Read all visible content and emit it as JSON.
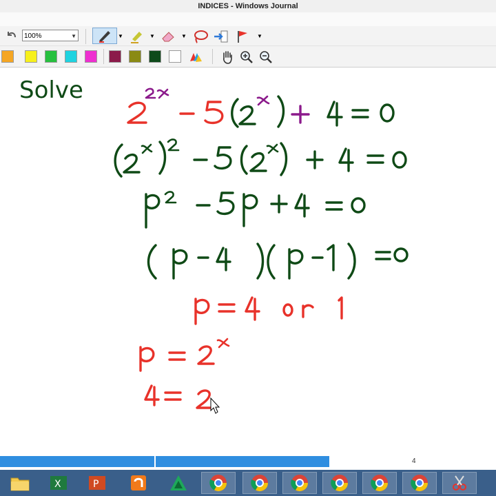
{
  "window": {
    "title": "INDICES - Windows Journal"
  },
  "toolbar": {
    "zoom_value": "100%",
    "tools": [
      "pen-icon",
      "highlighter-icon",
      "eraser-icon",
      "lasso-icon",
      "insert-space-icon",
      "flag-icon"
    ],
    "colors": [
      "#f5a623",
      "#f7f01b",
      "#27c03f",
      "#1fd3e0",
      "#ee2fd0",
      "#8b1a4a",
      "#8a8a14",
      "#0e4a1a",
      "#ffffff"
    ],
    "nav_tools": [
      "pan-hand-icon",
      "zoom-in-icon",
      "zoom-out-icon"
    ]
  },
  "note": {
    "solve_label": "Solve",
    "lines": [
      "2^2x − 5(2^x) + 4 = 0",
      "(2^x)^2 − 5(2^x) + 4 = 0",
      "p^2 − 5p + 4 = 0",
      "(p − 4)(p − 1) = 0",
      "p = 4 or 1",
      "p = 2^x",
      "4 = 2"
    ],
    "ink_colors": {
      "green": "#0f4a16",
      "red": "#e8322a",
      "purple": "#8b1a8b"
    }
  },
  "status": {
    "page_number": "4"
  },
  "taskbar": {
    "items": [
      "file-explorer-icon",
      "excel-icon",
      "powerpoint-icon",
      "pdf-app-icon",
      "app-icon",
      "chrome-icon",
      "chrome-icon",
      "chrome-icon",
      "chrome-icon",
      "chrome-icon",
      "chrome-icon",
      "snipping-tool-icon"
    ]
  }
}
